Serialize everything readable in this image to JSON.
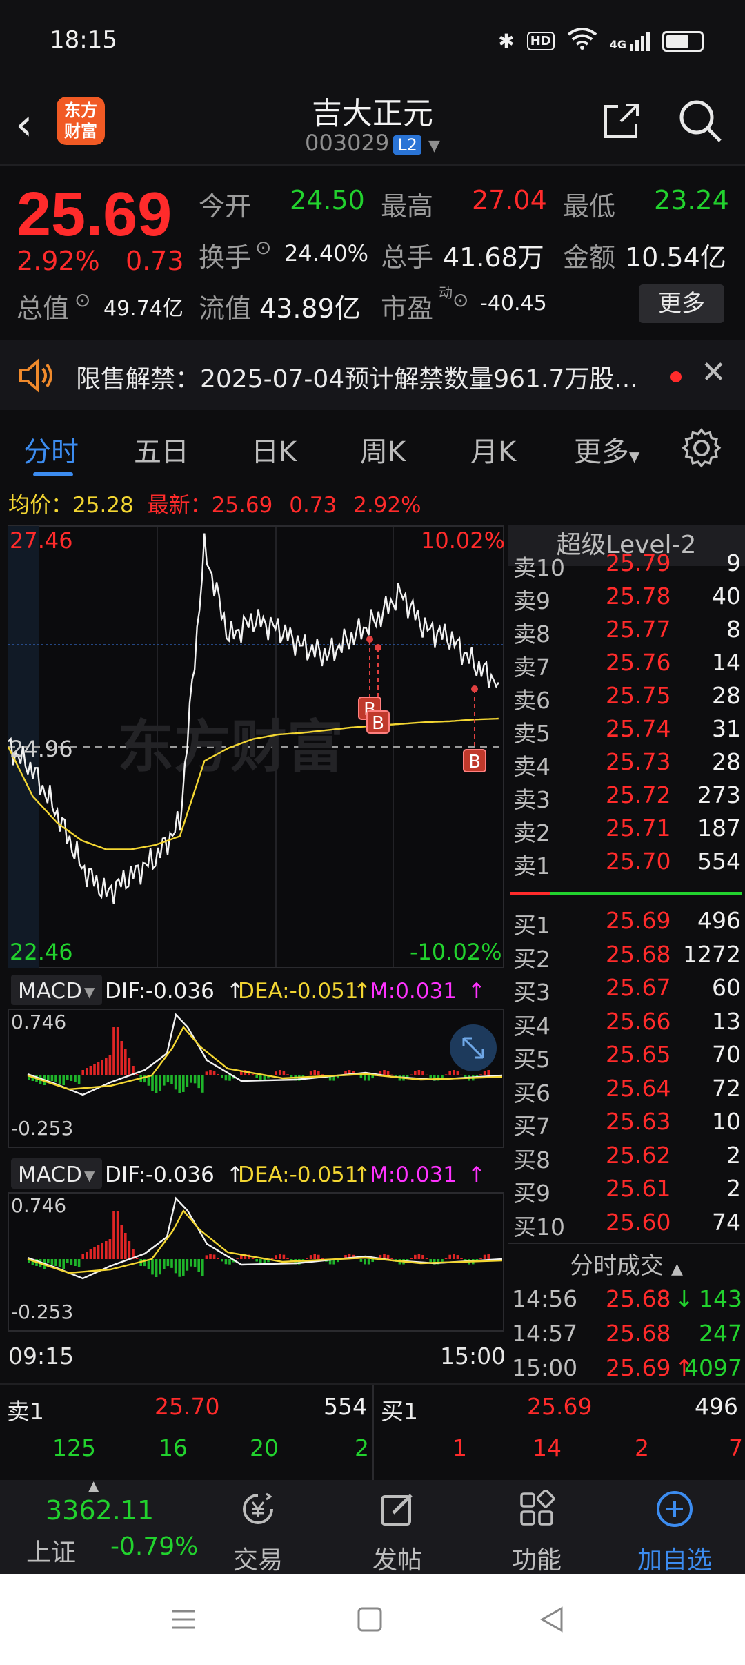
{
  "status_bar": {
    "time": "18:15",
    "hd": "HD",
    "network": "4G"
  },
  "header": {
    "logo_text_line1": "东方",
    "logo_text_line2": "财富",
    "title": "吉大正元",
    "code": "003029",
    "level_badge": "L2"
  },
  "quote": {
    "price": "25.69",
    "change_pct": "2.92%",
    "change": "0.73",
    "open_label": "今开",
    "open": "24.50",
    "high_label": "最高",
    "high": "27.04",
    "low_label": "最低",
    "low": "23.24",
    "turnover_label": "换手",
    "turnover": "24.40%",
    "volume_label": "总手",
    "volume": "41.68万",
    "amount_label": "金额",
    "amount": "10.54亿",
    "market_cap_label": "总值",
    "market_cap": "49.74亿",
    "float_cap_label": "流值",
    "float_cap": "43.89亿",
    "pe_label": "市盈",
    "pe_sup": "动",
    "pe": "-40.45",
    "more_button": "更多"
  },
  "notice": {
    "text": "限售解禁：2025-07-04预计解禁数量961.7万股..."
  },
  "tabs": [
    "分时",
    "五日",
    "日K",
    "周K",
    "月K",
    "更多"
  ],
  "chart": {
    "avg_label": "均价：",
    "avg": "25.28",
    "latest_label": "最新：",
    "latest": "25.69",
    "latest_change": "0.73",
    "latest_pct": "2.92%",
    "y_top": "27.46",
    "y_mid": "24.96",
    "y_bottom": "22.46",
    "pct_top": "10.02%",
    "pct_bottom": "-10.02%",
    "watermark": "东方财富",
    "marker": "B",
    "macd": {
      "name": "MACD",
      "dif": "DIF:-0.036",
      "dea": "DEA:-0.051",
      "m": "M:0.031",
      "y_top": "0.746",
      "y_bottom": "-0.253"
    },
    "time_start": "09:15",
    "time_end": "15:00"
  },
  "chart_data": {
    "type": "line",
    "title": "",
    "xlabel": "",
    "ylabel": "",
    "x_range": [
      "09:15",
      "15:00"
    ],
    "ylim": [
      22.46,
      27.46
    ],
    "prev_close": 24.96,
    "series": [
      {
        "name": "",
        "values": [
          24.96,
          24.7,
          24.2,
          23.6,
          23.3,
          23.5,
          23.7,
          24.1,
          27.2,
          26.2,
          26.4,
          26.3,
          26.1,
          26.0,
          26.2,
          26.4,
          26.7,
          26.3,
          26.2,
          25.9,
          25.69
        ]
      },
      {
        "name": "均价",
        "values": [
          24.96,
          24.4,
          24.1,
          23.9,
          23.8,
          23.8,
          23.85,
          23.95,
          24.8,
          24.95,
          25.05,
          25.1,
          25.12,
          25.15,
          25.18,
          25.2,
          25.22,
          25.24,
          25.25,
          25.27,
          25.28
        ]
      }
    ]
  },
  "level2": {
    "title": "超级Level-2",
    "asks": [
      {
        "label": "卖10",
        "price": "25.79",
        "vol": "9"
      },
      {
        "label": "卖9",
        "price": "25.78",
        "vol": "40"
      },
      {
        "label": "卖8",
        "price": "25.77",
        "vol": "8"
      },
      {
        "label": "卖7",
        "price": "25.76",
        "vol": "14"
      },
      {
        "label": "卖6",
        "price": "25.75",
        "vol": "28"
      },
      {
        "label": "卖5",
        "price": "25.74",
        "vol": "31"
      },
      {
        "label": "卖4",
        "price": "25.73",
        "vol": "28"
      },
      {
        "label": "卖3",
        "price": "25.72",
        "vol": "273"
      },
      {
        "label": "卖2",
        "price": "25.71",
        "vol": "187"
      },
      {
        "label": "卖1",
        "price": "25.70",
        "vol": "554"
      }
    ],
    "bids": [
      {
        "label": "买1",
        "price": "25.69",
        "vol": "496"
      },
      {
        "label": "买2",
        "price": "25.68",
        "vol": "1272"
      },
      {
        "label": "买3",
        "price": "25.67",
        "vol": "60"
      },
      {
        "label": "买4",
        "price": "25.66",
        "vol": "13"
      },
      {
        "label": "买5",
        "price": "25.65",
        "vol": "70"
      },
      {
        "label": "买6",
        "price": "25.64",
        "vol": "72"
      },
      {
        "label": "买7",
        "price": "25.63",
        "vol": "10"
      },
      {
        "label": "买8",
        "price": "25.62",
        "vol": "2"
      },
      {
        "label": "买9",
        "price": "25.61",
        "vol": "2"
      },
      {
        "label": "买10",
        "price": "25.60",
        "vol": "74"
      }
    ],
    "ticks_title": "分时成交",
    "ticks": [
      {
        "time": "14:56",
        "price": "25.68",
        "arrow": "↓",
        "vol": "143"
      },
      {
        "time": "14:57",
        "price": "25.68",
        "arrow": "",
        "vol": "247"
      },
      {
        "time": "15:00",
        "price": "25.69",
        "arrow": "↑",
        "vol": "4097"
      }
    ]
  },
  "strip": {
    "sell_label": "卖1",
    "sell_price": "25.70",
    "sell_vol": "554",
    "buy_label": "买1",
    "buy_price": "25.69",
    "buy_vol": "496",
    "sell_row": [
      "125",
      "16",
      "20",
      "2"
    ],
    "buy_row": [
      "1",
      "14",
      "2",
      "7"
    ]
  },
  "bottom_nav": {
    "index_value": "3362.11",
    "index_name": "上证",
    "index_change": "-0.79%",
    "trade": "交易",
    "post": "发帖",
    "function": "功能",
    "watchlist": "加自选"
  },
  "colors": {
    "up": "#ff2b2b",
    "down": "#22d22e",
    "accent": "#3c8cf0",
    "avg_line": "#f3d632"
  }
}
